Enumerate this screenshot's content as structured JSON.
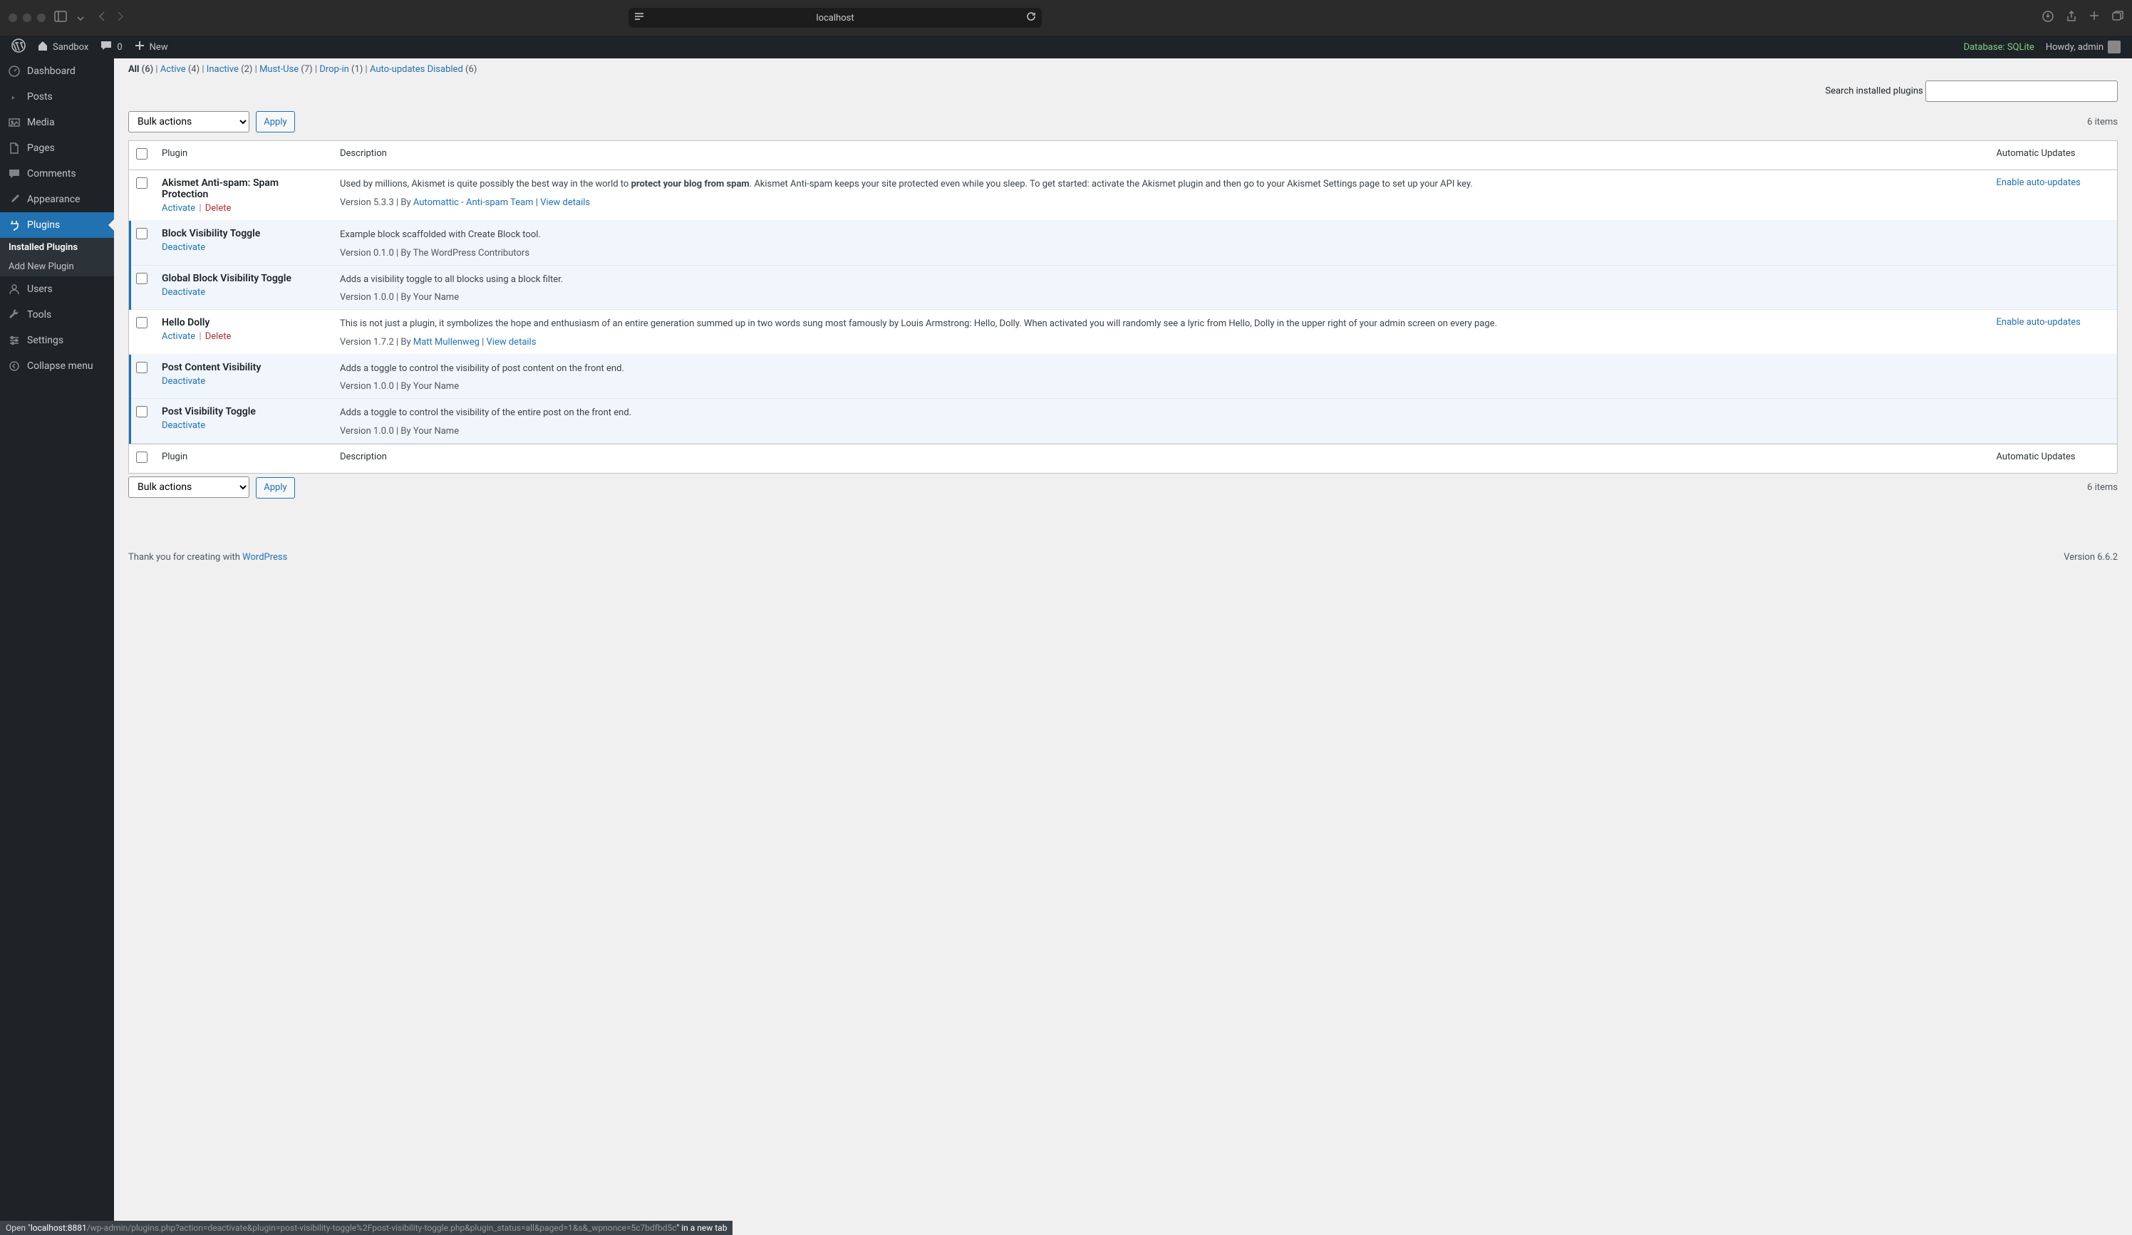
{
  "browser": {
    "url": "localhost"
  },
  "adminbar": {
    "site_name": "Sandbox",
    "comments_count": "0",
    "new_label": "New",
    "database": "Database: SQLite",
    "howdy": "Howdy, admin"
  },
  "sidebar": {
    "items": [
      {
        "icon": "dashboard",
        "label": "Dashboard"
      },
      {
        "icon": "posts",
        "label": "Posts"
      },
      {
        "icon": "media",
        "label": "Media"
      },
      {
        "icon": "pages",
        "label": "Pages"
      },
      {
        "icon": "comments",
        "label": "Comments"
      },
      {
        "icon": "appearance",
        "label": "Appearance"
      },
      {
        "icon": "plugins",
        "label": "Plugins"
      },
      {
        "icon": "users",
        "label": "Users"
      },
      {
        "icon": "tools",
        "label": "Tools"
      },
      {
        "icon": "settings",
        "label": "Settings"
      }
    ],
    "submenu": {
      "installed": "Installed Plugins",
      "add_new": "Add New Plugin"
    },
    "collapse": "Collapse menu"
  },
  "filters": {
    "all": {
      "label": "All",
      "count": "(6)"
    },
    "active": {
      "label": "Active",
      "count": "(4)"
    },
    "inactive": {
      "label": "Inactive",
      "count": "(2)"
    },
    "mustuse": {
      "label": "Must-Use",
      "count": "(7)"
    },
    "dropin": {
      "label": "Drop-in",
      "count": "(1)"
    },
    "auto_disabled": {
      "label": "Auto-updates Disabled",
      "count": "(6)"
    }
  },
  "search": {
    "label": "Search installed plugins"
  },
  "bulk": {
    "label": "Bulk actions",
    "apply": "Apply"
  },
  "pagination": {
    "items": "6 items"
  },
  "columns": {
    "plugin": "Plugin",
    "description": "Description",
    "auto": "Automatic Updates"
  },
  "actions": {
    "activate": "Activate",
    "deactivate": "Deactivate",
    "delete": "Delete",
    "enable_auto": "Enable auto-updates",
    "view_details": "View details"
  },
  "plugins": [
    {
      "name": "Akismet Anti-spam: Spam Protection",
      "active": false,
      "desc_pre": "Used by millions, Akismet is quite possibly the best way in the world to ",
      "desc_bold": "protect your blog from spam",
      "desc_post": ". Akismet Anti-spam keeps your site protected even while you sleep. To get started: activate the Akismet plugin and then go to your Akismet Settings page to set up your API key.",
      "version": "Version 5.3.3 | By ",
      "author": "Automattic - Anti-spam Team",
      "author_link": true,
      "view_details": true,
      "auto_update": true
    },
    {
      "name": "Block Visibility Toggle",
      "active": true,
      "desc_pre": "Example block scaffolded with Create Block tool.",
      "version": "Version 0.1.0 | By The WordPress Contributors",
      "author": "",
      "author_link": false,
      "view_details": false,
      "auto_update": false
    },
    {
      "name": "Global Block Visibility Toggle",
      "active": true,
      "desc_pre": "Adds a visibility toggle to all blocks using a block filter.",
      "version": "Version 1.0.0 | By Your Name",
      "author": "",
      "author_link": false,
      "view_details": false,
      "auto_update": false
    },
    {
      "name": "Hello Dolly",
      "active": false,
      "desc_pre": "This is not just a plugin, it symbolizes the hope and enthusiasm of an entire generation summed up in two words sung most famously by Louis Armstrong: Hello, Dolly. When activated you will randomly see a lyric from Hello, Dolly in the upper right of your admin screen on every page.",
      "version": "Version 1.7.2 | By ",
      "author": "Matt Mullenweg",
      "author_link": true,
      "view_details": true,
      "auto_update": true
    },
    {
      "name": "Post Content Visibility",
      "active": true,
      "desc_pre": "Adds a toggle to control the visibility of post content on the front end.",
      "version": "Version 1.0.0 | By Your Name",
      "author": "",
      "author_link": false,
      "view_details": false,
      "auto_update": false
    },
    {
      "name": "Post Visibility Toggle",
      "active": true,
      "desc_pre": "Adds a toggle to control the visibility of the entire post on the front end.",
      "version": "Version 1.0.0 | By Your Name",
      "author": "",
      "author_link": false,
      "view_details": false,
      "auto_update": false
    }
  ],
  "footer": {
    "thanks_pre": "Thank you for creating with ",
    "thanks_link": "WordPress",
    "version": "Version 6.6.2"
  },
  "statusbar": {
    "pre": "Open \"",
    "host": "localhost:8881",
    "path": "/wp-admin/plugins.php?action=deactivate&plugin=post-visibility-toggle%2Fpost-visibility-toggle.php&plugin_status=all&paged=1&s&_wpnonce=5c7bdfbd5c",
    "post": "\" in a new tab"
  }
}
